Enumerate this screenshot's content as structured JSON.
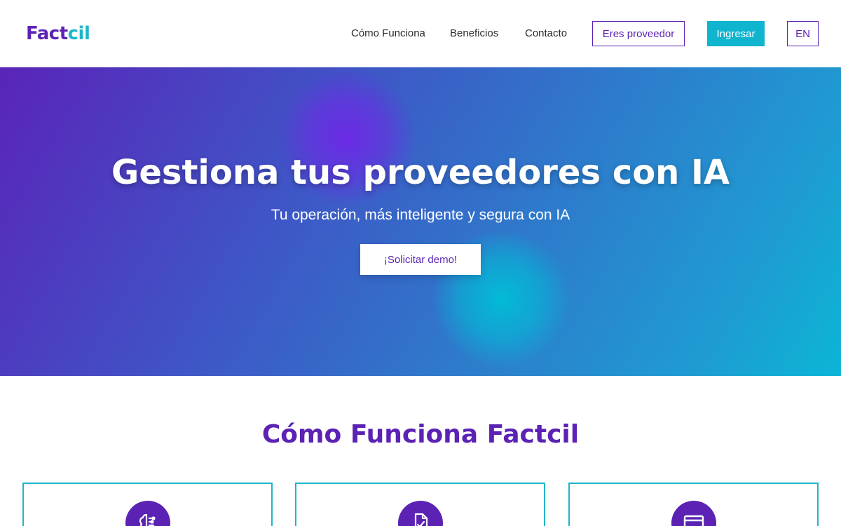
{
  "brand": {
    "logo_part1": "Fact",
    "logo_part2": "cil"
  },
  "nav": {
    "links": [
      "Cómo Funciona",
      "Beneficios",
      "Contacto"
    ],
    "provider_label": "Eres proveedor",
    "login_label": "Ingresar",
    "lang_label": "EN"
  },
  "hero": {
    "title": "Gestiona tus proveedores con IA",
    "subtitle": "Tu operación, más inteligente y segura con IA",
    "cta_label": "¡Solicitar demo!"
  },
  "how_it_works": {
    "title": "Cómo Funciona Factcil",
    "cards": [
      {
        "icon": "brain-icon"
      },
      {
        "icon": "document-check-icon"
      },
      {
        "icon": "credit-card-icon"
      }
    ]
  },
  "colors": {
    "brand_purple": "#5b22b4",
    "brand_cyan": "#1fb6c9",
    "login_bg": "#0fb4cf"
  }
}
